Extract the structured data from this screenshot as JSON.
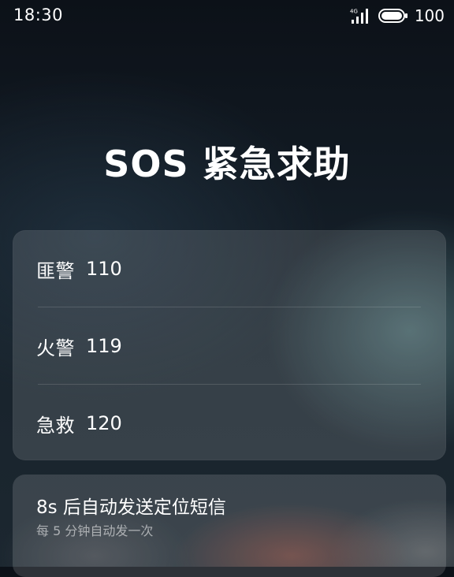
{
  "status_bar": {
    "time": "18:30",
    "network_label": "4G",
    "battery_level": "100",
    "icons": [
      "signal-4g-icon",
      "battery-icon"
    ]
  },
  "title": "SOS 紧急求助",
  "contacts": [
    {
      "label": "匪警",
      "number": "110"
    },
    {
      "label": "火警",
      "number": "119"
    },
    {
      "label": "急救",
      "number": "120"
    }
  ],
  "auto_sms": {
    "title": "8s 后自动发送定位短信",
    "subtitle": "每 5 分钟自动发一次"
  },
  "colors": {
    "text": "#ffffff",
    "card": "rgba(255,255,255,0.13)",
    "background": "#121b24"
  }
}
